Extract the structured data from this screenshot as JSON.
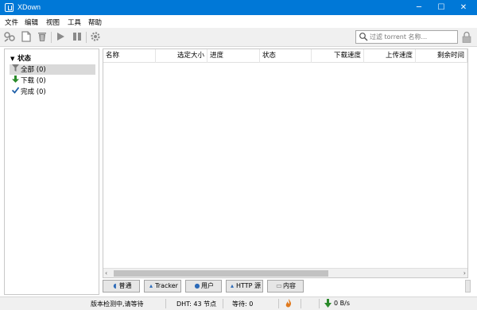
{
  "window": {
    "title": "XDown",
    "minimize_glyph": "─",
    "maximize_glyph": "☐",
    "close_glyph": "✕"
  },
  "menu": [
    "文件",
    "编辑",
    "视图",
    "工具",
    "帮助"
  ],
  "toolbar": {
    "icons": [
      "add-link-icon",
      "add-file-icon",
      "delete-icon",
      "start-icon",
      "pause-icon",
      "settings-icon"
    ],
    "search_placeholder": "过滤 torrent 名称...",
    "lock_icon": "lock-icon"
  },
  "sidebar": {
    "header": "状态",
    "items": [
      {
        "label": "全部 (0)",
        "icon": "filter-icon",
        "color": "#7a7a7a"
      },
      {
        "label": "下载 (0)",
        "icon": "down-arrow-icon",
        "color": "#2a8a2a"
      },
      {
        "label": "完成 (0)",
        "icon": "check-icon",
        "color": "#1f5fa8"
      }
    ]
  },
  "table": {
    "columns": [
      "名称",
      "选定大小",
      "进度",
      "状态",
      "下载速度",
      "上传速度",
      "剩余时间"
    ]
  },
  "tabs": [
    "普通",
    "Tracker",
    "用户",
    "HTTP 源",
    "内容"
  ],
  "status": {
    "message": "版本检测中,请等待",
    "dht": "DHT: 43 节点",
    "waiting": "等待: 0",
    "speed": "0 B/s"
  }
}
